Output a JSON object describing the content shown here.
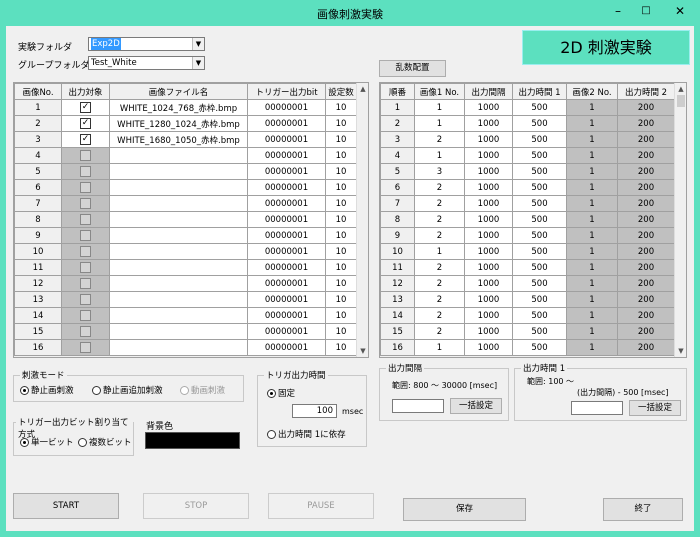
{
  "window": {
    "title": "画像刺激実験",
    "minimize": "–",
    "maximize": "□",
    "close": "✕"
  },
  "header": {
    "experiment_folder_label": "実験フォルダ",
    "experiment_folder_value": "Exp2D",
    "group_folder_label": "グループフォルダ",
    "group_folder_value": "Test_White",
    "banner": "2D 刺激実験",
    "shuffle_button": "乱数配置"
  },
  "image_table": {
    "columns": [
      "画像No.",
      "出力対象",
      "画像ファイル名",
      "トリガー出力bit",
      "設定数"
    ],
    "rows": [
      {
        "no": "1",
        "checked": true,
        "file": "WHITE_1024_768_赤枠.bmp",
        "bit": "00000001",
        "count": "10"
      },
      {
        "no": "2",
        "checked": true,
        "file": "WHITE_1280_1024_赤枠.bmp",
        "bit": "00000001",
        "count": "10"
      },
      {
        "no": "3",
        "checked": true,
        "file": "WHITE_1680_1050_赤枠.bmp",
        "bit": "00000001",
        "count": "10"
      },
      {
        "no": "4",
        "checked": false,
        "file": "",
        "bit": "00000001",
        "count": "10"
      },
      {
        "no": "5",
        "checked": false,
        "file": "",
        "bit": "00000001",
        "count": "10"
      },
      {
        "no": "6",
        "checked": false,
        "file": "",
        "bit": "00000001",
        "count": "10"
      },
      {
        "no": "7",
        "checked": false,
        "file": "",
        "bit": "00000001",
        "count": "10"
      },
      {
        "no": "8",
        "checked": false,
        "file": "",
        "bit": "00000001",
        "count": "10"
      },
      {
        "no": "9",
        "checked": false,
        "file": "",
        "bit": "00000001",
        "count": "10"
      },
      {
        "no": "10",
        "checked": false,
        "file": "",
        "bit": "00000001",
        "count": "10"
      },
      {
        "no": "11",
        "checked": false,
        "file": "",
        "bit": "00000001",
        "count": "10"
      },
      {
        "no": "12",
        "checked": false,
        "file": "",
        "bit": "00000001",
        "count": "10"
      },
      {
        "no": "13",
        "checked": false,
        "file": "",
        "bit": "00000001",
        "count": "10"
      },
      {
        "no": "14",
        "checked": false,
        "file": "",
        "bit": "00000001",
        "count": "10"
      },
      {
        "no": "15",
        "checked": false,
        "file": "",
        "bit": "00000001",
        "count": "10"
      },
      {
        "no": "16",
        "checked": false,
        "file": "",
        "bit": "00000001",
        "count": "10"
      }
    ]
  },
  "sequence_table": {
    "columns": [
      "順番",
      "画像1 No.",
      "出力間隔",
      "出力時間 1",
      "画像2 No.",
      "出力時間 2"
    ],
    "rows": [
      [
        "1",
        "1",
        "1000",
        "500",
        "1",
        "200"
      ],
      [
        "2",
        "1",
        "1000",
        "500",
        "1",
        "200"
      ],
      [
        "3",
        "2",
        "1000",
        "500",
        "1",
        "200"
      ],
      [
        "4",
        "1",
        "1000",
        "500",
        "1",
        "200"
      ],
      [
        "5",
        "3",
        "1000",
        "500",
        "1",
        "200"
      ],
      [
        "6",
        "2",
        "1000",
        "500",
        "1",
        "200"
      ],
      [
        "7",
        "2",
        "1000",
        "500",
        "1",
        "200"
      ],
      [
        "8",
        "2",
        "1000",
        "500",
        "1",
        "200"
      ],
      [
        "9",
        "2",
        "1000",
        "500",
        "1",
        "200"
      ],
      [
        "10",
        "1",
        "1000",
        "500",
        "1",
        "200"
      ],
      [
        "11",
        "2",
        "1000",
        "500",
        "1",
        "200"
      ],
      [
        "12",
        "2",
        "1000",
        "500",
        "1",
        "200"
      ],
      [
        "13",
        "2",
        "1000",
        "500",
        "1",
        "200"
      ],
      [
        "14",
        "2",
        "1000",
        "500",
        "1",
        "200"
      ],
      [
        "15",
        "2",
        "1000",
        "500",
        "1",
        "200"
      ],
      [
        "16",
        "1",
        "1000",
        "500",
        "1",
        "200"
      ]
    ]
  },
  "stim_mode": {
    "caption": "刺激モード",
    "options": [
      {
        "label": "静止画刺激",
        "selected": true,
        "enabled": true
      },
      {
        "label": "静止画追加刺激",
        "selected": false,
        "enabled": true
      },
      {
        "label": "動画刺激",
        "selected": false,
        "enabled": false
      }
    ]
  },
  "trigger_assign": {
    "caption": "トリガー出力ビット割り当て方式",
    "options": [
      {
        "label": "単一ビット",
        "selected": true
      },
      {
        "label": "複数ビット",
        "selected": false
      }
    ]
  },
  "background_color": {
    "label": "背景色",
    "color": "#000000"
  },
  "trigger_time": {
    "caption": "トリガ出力時間",
    "fixed_label": "固定",
    "fixed_selected": true,
    "value": "100",
    "unit": "msec",
    "depend_label": "出力時間 1に依存",
    "depend_selected": false
  },
  "output_interval": {
    "caption": "出力間隔",
    "range": "範囲: 800 〜 30000 [msec]",
    "value": "",
    "apply_button": "一括設定"
  },
  "output_time1": {
    "caption": "出力時間 1",
    "range_line1": "範囲: 100 〜",
    "range_line2": "(出力間隔) - 500 [msec]",
    "value": "",
    "apply_button": "一括設定"
  },
  "buttons": {
    "start": "START",
    "stop": "STOP",
    "pause": "PAUSE",
    "save": "保存",
    "exit": "終了"
  }
}
